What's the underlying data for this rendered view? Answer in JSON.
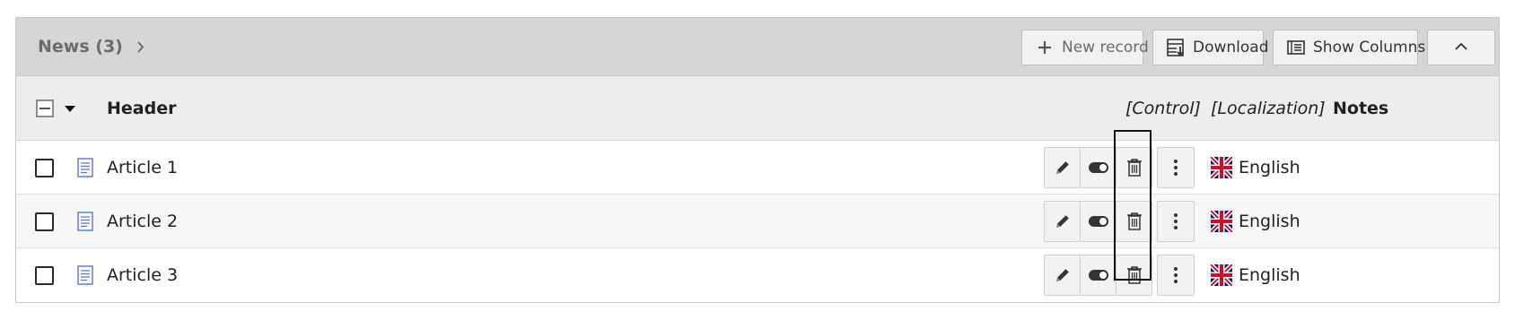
{
  "panel": {
    "title": "News (3)",
    "toolbar": {
      "new_record": "New record",
      "download": "Download",
      "show_columns": "Show Columns"
    }
  },
  "table": {
    "columns": {
      "header": "Header",
      "control": "[Control]",
      "localization": "[Localization]",
      "notes": "Notes"
    },
    "rows": [
      {
        "title": "Article 1",
        "language": "English"
      },
      {
        "title": "Article 2",
        "language": "English"
      },
      {
        "title": "Article 3",
        "language": "English"
      }
    ]
  },
  "icons": {
    "chevron": "chevron-right-icon",
    "new": "plus-icon",
    "download": "download-icon",
    "columns": "columns-icon",
    "collapse": "chevron-up-icon",
    "record": "page-icon",
    "edit": "pencil-icon",
    "toggle": "toggle-icon",
    "delete": "trash-icon",
    "more": "ellipsis-vertical-icon",
    "flag": "uk-flag-icon"
  },
  "colors": {
    "header_bg": "#d6d6d6",
    "thead_bg": "#ededed",
    "record_icon": "#5a6fd6"
  }
}
